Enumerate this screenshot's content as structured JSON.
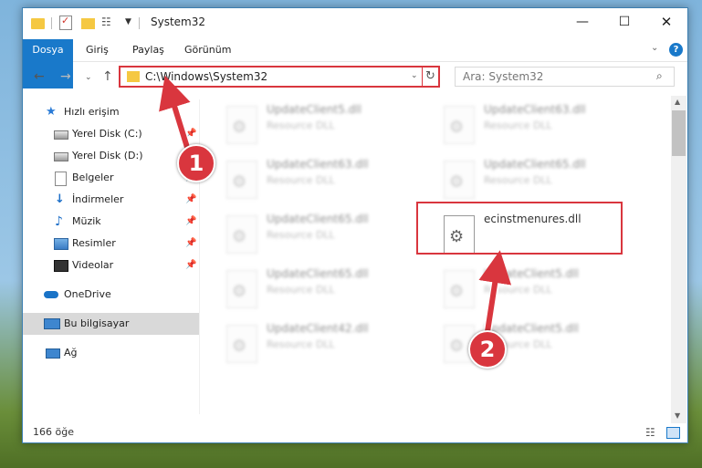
{
  "window": {
    "title": "System32",
    "controls": {
      "minimize": "—",
      "maximize": "☐",
      "close": "✕"
    }
  },
  "ribbon": {
    "tabs": [
      "Dosya",
      "Giriş",
      "Paylaş",
      "Görünüm"
    ],
    "expand": "⌄",
    "help": "?"
  },
  "navigation": {
    "address": "C:\\Windows\\System32",
    "search_placeholder": "Ara: System32"
  },
  "sidebar": {
    "items": [
      {
        "label": "Hızlı erişim",
        "icon": "quick-access-star-icon",
        "pinned": false
      },
      {
        "label": "Yerel Disk (C:)",
        "icon": "drive-icon",
        "pinned": true
      },
      {
        "label": "Yerel Disk (D:)",
        "icon": "drive-icon",
        "pinned": true
      },
      {
        "label": "Belgeler",
        "icon": "documents-icon",
        "pinned": true
      },
      {
        "label": "İndirmeler",
        "icon": "downloads-icon",
        "pinned": true
      },
      {
        "label": "Müzik",
        "icon": "music-icon",
        "pinned": true
      },
      {
        "label": "Resimler",
        "icon": "pictures-icon",
        "pinned": true
      },
      {
        "label": "Videolar",
        "icon": "videos-icon",
        "pinned": true
      },
      {
        "label": "OneDrive",
        "icon": "onedrive-icon",
        "pinned": false
      },
      {
        "label": "Bu bilgisayar",
        "icon": "this-pc-icon",
        "pinned": false
      },
      {
        "label": "Ağ",
        "icon": "network-icon",
        "pinned": false
      }
    ]
  },
  "files": [
    {
      "name": "UpdateClient5.dll",
      "desc": "Resource DLL"
    },
    {
      "name": "UpdateClient63.dll",
      "desc": "Resource DLL"
    },
    {
      "name": "UpdateClient63.dll",
      "desc": "Resource DLL"
    },
    {
      "name": "UpdateClient65.dll",
      "desc": "Resource DLL"
    },
    {
      "name": "UpdateClient65.dll",
      "desc": "Resource DLL"
    },
    {
      "name": "ecinstmenures.dll",
      "desc": ""
    },
    {
      "name": "UpdateClient65.dll",
      "desc": "Resource DLL"
    },
    {
      "name": "UpdateClient5.dll",
      "desc": "Resource DLL"
    },
    {
      "name": "UpdateClient42.dll",
      "desc": "Resource DLL"
    },
    {
      "name": "UpdateClient5.dll",
      "desc": "Resource DLL"
    }
  ],
  "status": {
    "count": "166 öğe"
  },
  "annotations": {
    "step1": "1",
    "step2": "2",
    "color": "#d9363e"
  }
}
